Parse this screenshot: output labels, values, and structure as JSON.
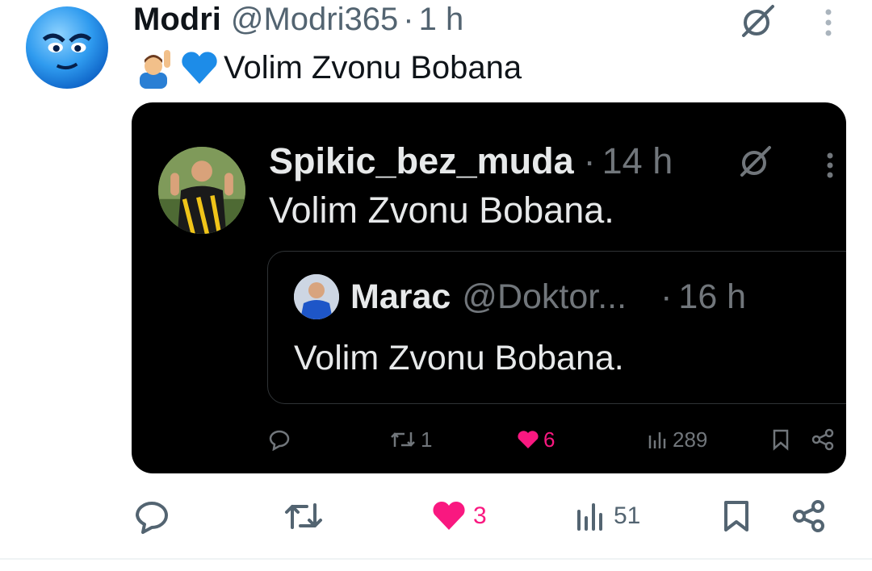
{
  "post": {
    "author": {
      "display_name": "Modri",
      "handle": "@Modri365"
    },
    "separator": "·",
    "time": "1 h",
    "text": "Volim Zvonu Bobana",
    "emojis": [
      "person-raising-hand-emoji",
      "blue-heart-emoji"
    ],
    "stats": {
      "likes": "3",
      "views": "51"
    }
  },
  "embedded_screenshot": {
    "author": {
      "display_name": "Spikic_bez_muda"
    },
    "separator": "·",
    "time": "14 h",
    "text": "Volim Zvonu Bobana.",
    "stats": {
      "retweets": "1",
      "likes": "6",
      "views": "289"
    },
    "quoted": {
      "author": {
        "display_name": "Marac",
        "handle": "@Doktor..."
      },
      "separator": "·",
      "time": "16 h",
      "text": "Volim Zvonu Bobana."
    }
  },
  "colors": {
    "text_primary": "#0f1419",
    "text_secondary": "#536471",
    "like_pink": "#f91880",
    "dark_bg": "#000000",
    "dark_text": "#e7e9ea"
  }
}
